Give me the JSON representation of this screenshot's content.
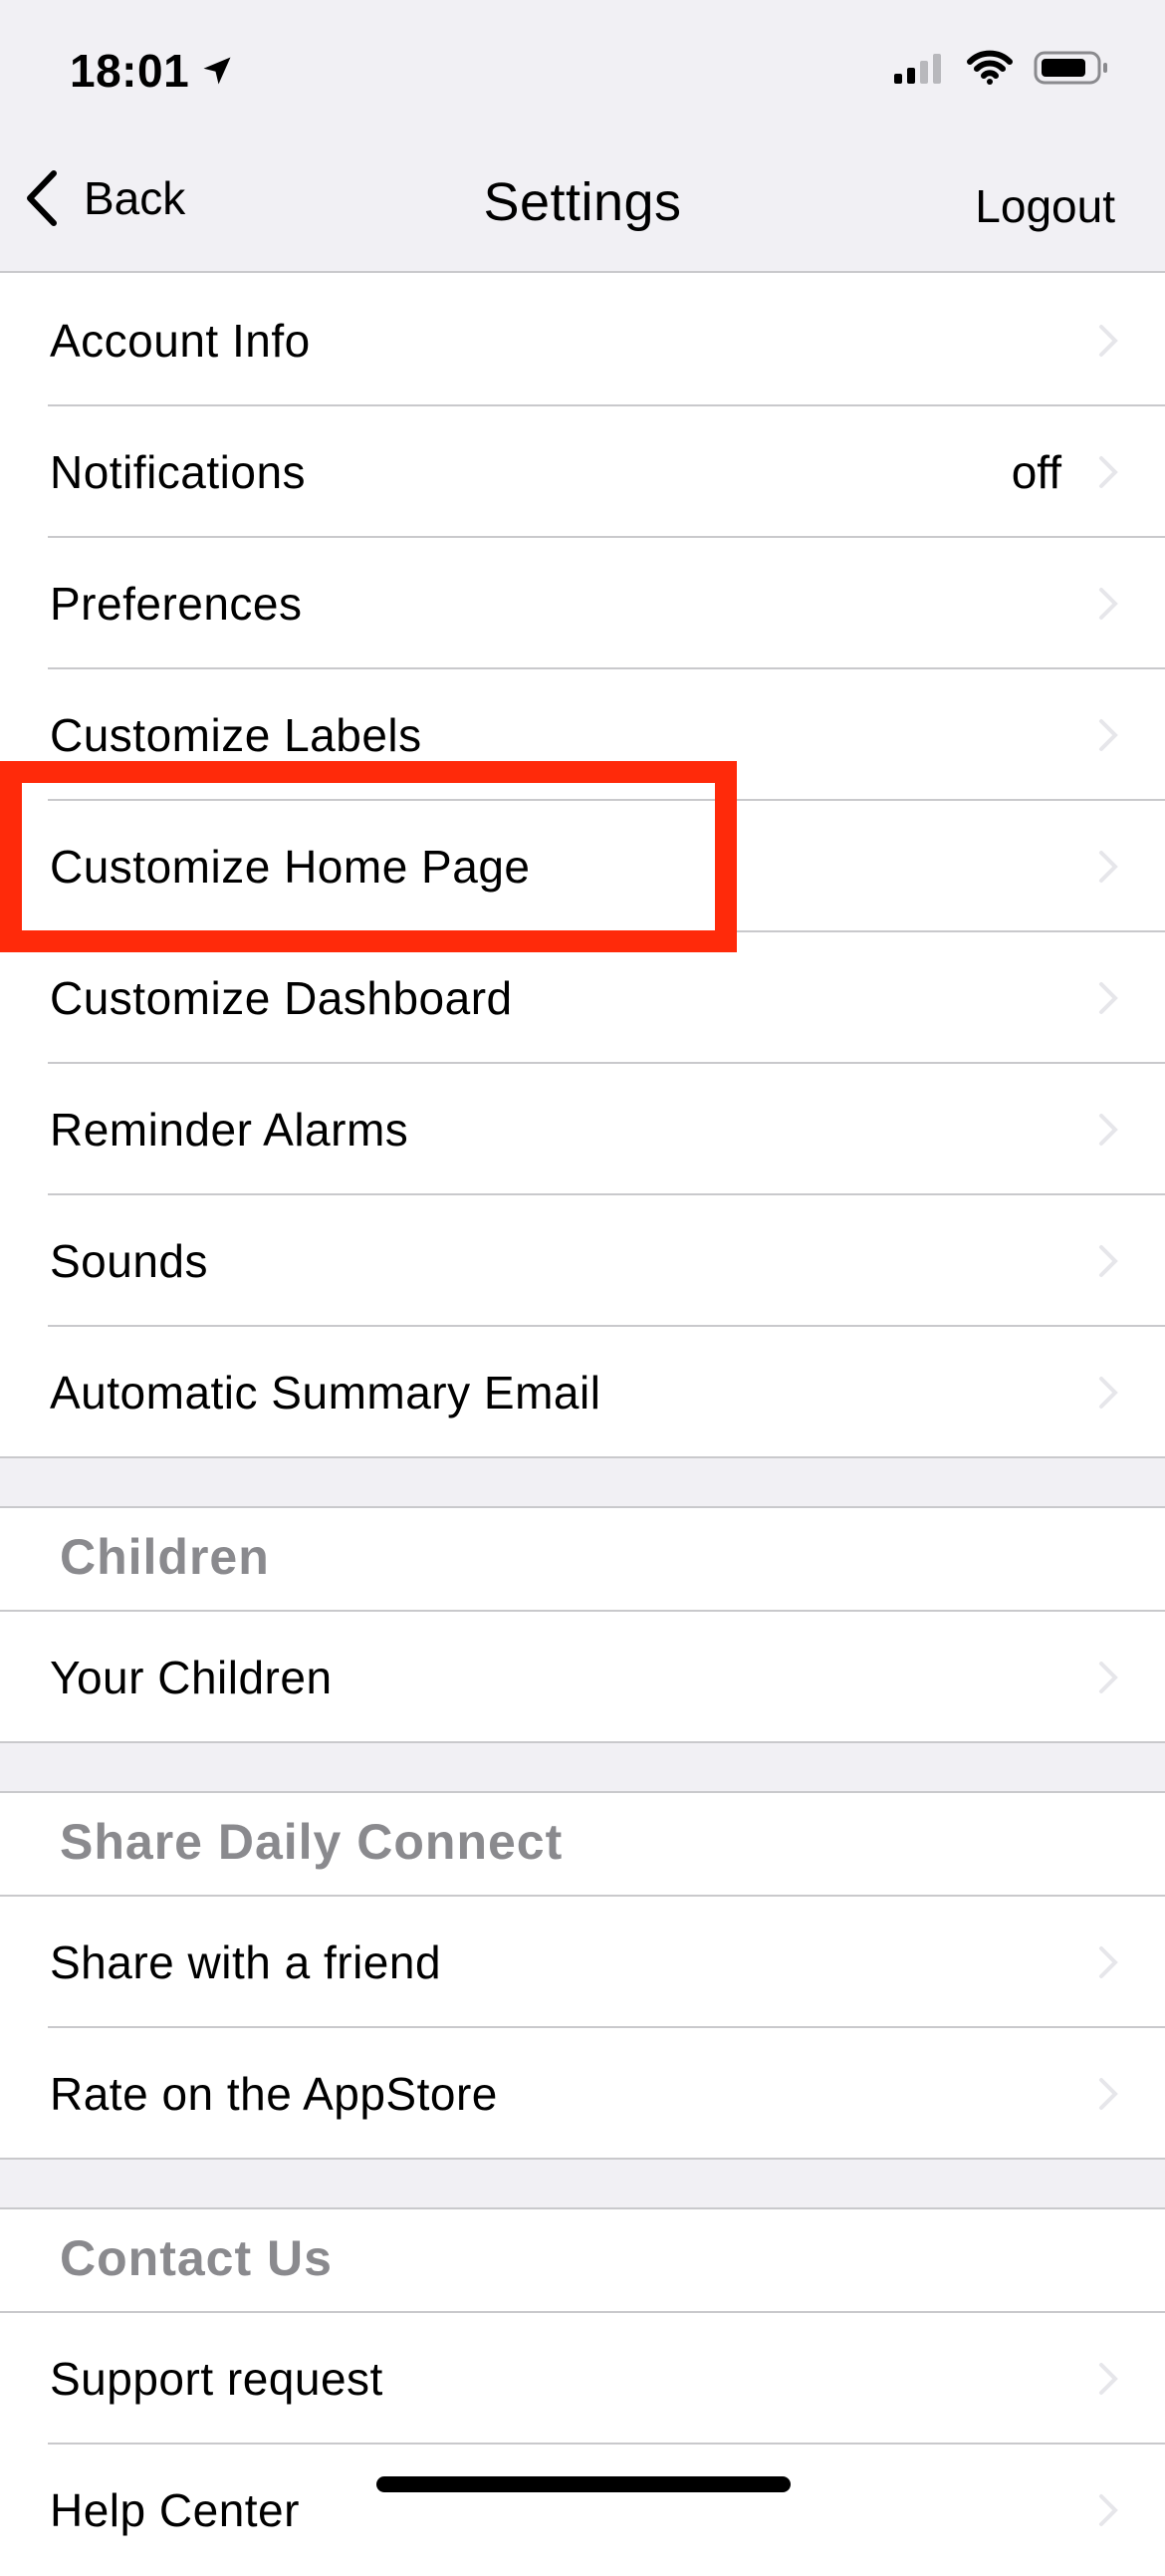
{
  "status_bar": {
    "time": "18:01"
  },
  "nav": {
    "back_label": "Back",
    "title": "Settings",
    "logout_label": "Logout"
  },
  "rows_main": [
    {
      "label": "Account Info",
      "value": ""
    },
    {
      "label": "Notifications",
      "value": "off"
    },
    {
      "label": "Preferences",
      "value": ""
    },
    {
      "label": "Customize Labels",
      "value": ""
    },
    {
      "label": "Customize Home Page",
      "value": ""
    },
    {
      "label": "Customize Dashboard",
      "value": ""
    },
    {
      "label": "Reminder Alarms",
      "value": ""
    },
    {
      "label": "Sounds",
      "value": ""
    },
    {
      "label": "Automatic Summary Email",
      "value": ""
    }
  ],
  "sections": {
    "children": {
      "header": "Children",
      "rows": [
        {
          "label": "Your Children"
        }
      ]
    },
    "share": {
      "header": "Share Daily Connect",
      "rows": [
        {
          "label": "Share with a friend"
        },
        {
          "label": "Rate on the AppStore"
        }
      ]
    },
    "contact": {
      "header": "Contact Us",
      "rows": [
        {
          "label": "Support request"
        },
        {
          "label": "Help Center"
        }
      ]
    }
  },
  "colors": {
    "highlight": "#ff2a0a",
    "section_header_text": "#8a8a8e",
    "background_gray": "#f1f0f4"
  },
  "icons": [
    "location-arrow-icon",
    "cellular-signal-icon",
    "wifi-icon",
    "battery-icon",
    "back-chevron-icon",
    "chevron-right-icon"
  ]
}
